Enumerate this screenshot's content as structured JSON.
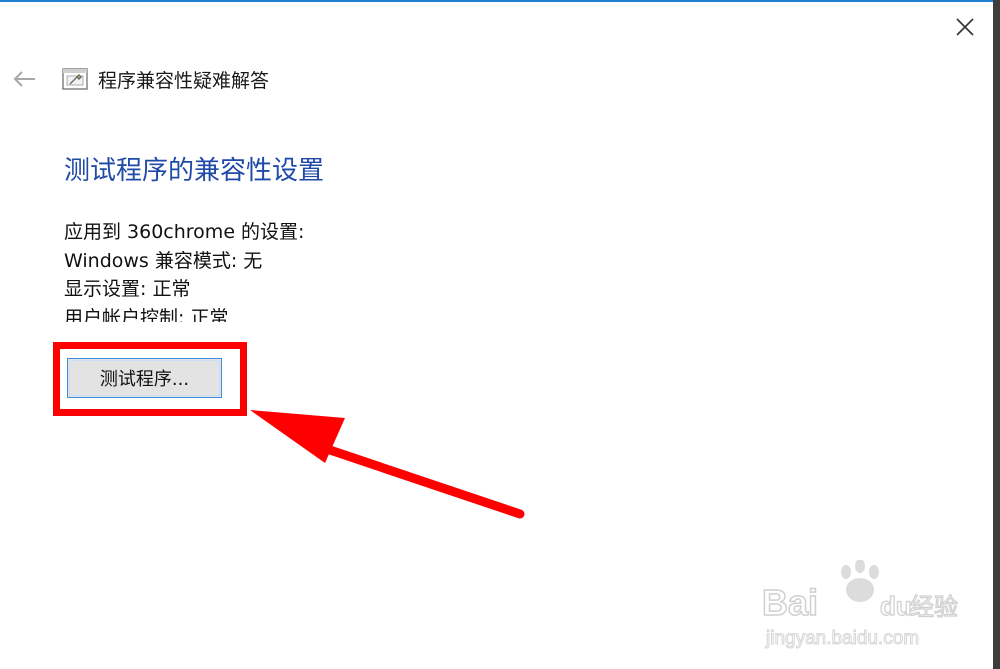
{
  "window": {
    "close_icon": "close-icon",
    "back_icon": "back-arrow-icon"
  },
  "header": {
    "title": "程序兼容性疑难解答",
    "icon": "troubleshooter-icon"
  },
  "main": {
    "heading": "测试程序的兼容性设置",
    "details": [
      "应用到 360chrome 的设置:",
      "Windows 兼容模式: 无",
      "显示设置: 正常",
      "用户帐户控制: 正常"
    ],
    "test_button_label": "测试程序..."
  },
  "annotation": {
    "highlight_color": "#ff0000"
  },
  "watermark": {
    "brand": "Bai",
    "brand2": "du",
    "product": "经验",
    "url": "jingyan.baidu.com"
  },
  "colors": {
    "heading": "#1f4aa8",
    "accent_border": "#1e7fd1",
    "button_border": "#3c8ee0"
  }
}
